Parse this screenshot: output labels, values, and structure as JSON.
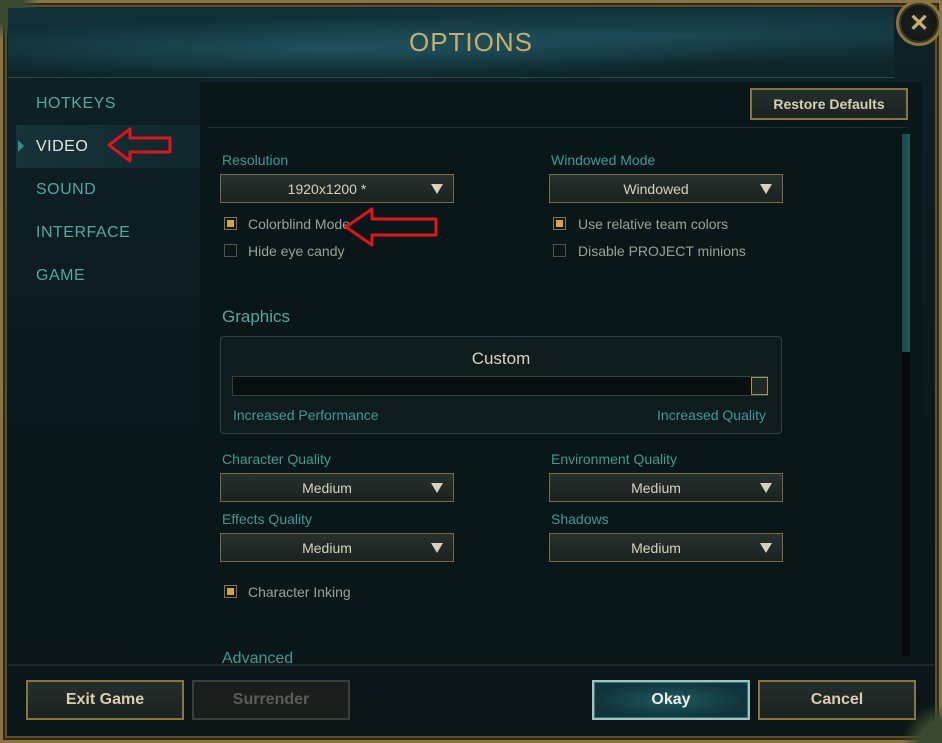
{
  "window": {
    "title": "OPTIONS",
    "close_icon": "close-icon"
  },
  "sidebar": {
    "items": [
      {
        "label": "HOTKEYS",
        "active": false
      },
      {
        "label": "VIDEO",
        "active": true
      },
      {
        "label": "SOUND",
        "active": false
      },
      {
        "label": "INTERFACE",
        "active": false
      },
      {
        "label": "GAME",
        "active": false
      }
    ]
  },
  "panel": {
    "restore_label": "Restore Defaults",
    "resolution": {
      "label": "Resolution",
      "value": "1920x1200 *"
    },
    "windowed_mode": {
      "label": "Windowed Mode",
      "value": "Windowed"
    },
    "checkboxes": {
      "colorblind": {
        "label": "Colorblind Mode",
        "checked": true
      },
      "hide_eye_candy": {
        "label": "Hide eye candy",
        "checked": false
      },
      "relative_team_colors": {
        "label": "Use relative team colors",
        "checked": true
      },
      "disable_project_minions": {
        "label": "Disable PROJECT minions",
        "checked": false
      },
      "character_inking": {
        "label": "Character Inking",
        "checked": true
      }
    },
    "graphics": {
      "heading": "Graphics",
      "preset": "Custom",
      "slider_level": 1.0,
      "left_caption": "Increased Performance",
      "right_caption": "Increased Quality"
    },
    "character_quality": {
      "label": "Character Quality",
      "value": "Medium"
    },
    "environment_quality": {
      "label": "Environment Quality",
      "value": "Medium"
    },
    "effects_quality": {
      "label": "Effects Quality",
      "value": "Medium"
    },
    "shadows": {
      "label": "Shadows",
      "value": "Medium"
    },
    "advanced_heading": "Advanced"
  },
  "footer": {
    "exit_label": "Exit Game",
    "surrender_label": "Surrender",
    "okay_label": "Okay",
    "cancel_label": "Cancel"
  },
  "colors": {
    "gold_border": "#8a7440",
    "teal_text": "#3e9a94",
    "annotation_red": "#e0141a"
  },
  "annotations": {
    "arrow_icon": "red-arrow-icon",
    "count": 2
  }
}
